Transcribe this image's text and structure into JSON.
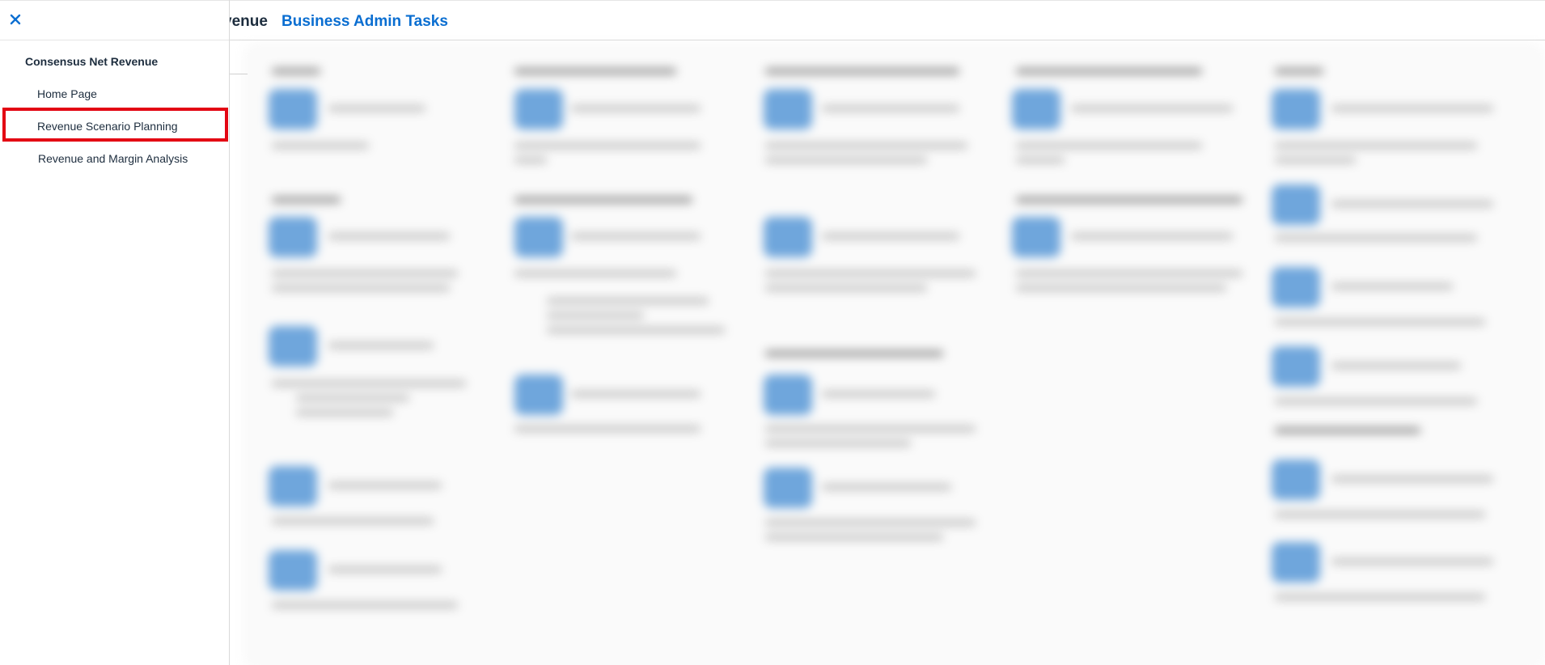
{
  "header": {
    "prev_tab_label": "venue",
    "active_tab_label": "Business Admin Tasks"
  },
  "sidenav": {
    "group_title": "Consensus Net Revenue",
    "items": [
      {
        "label": "Home Page"
      },
      {
        "label": "Revenue Scenario Planning",
        "highlighted": true
      },
      {
        "label": "Revenue and Margin Analysis"
      }
    ]
  },
  "colors": {
    "accent": "#0a6ed1",
    "highlight": "#e30613",
    "tile_blue": "#6fa6dc"
  },
  "icons": {
    "close": "close-icon"
  }
}
